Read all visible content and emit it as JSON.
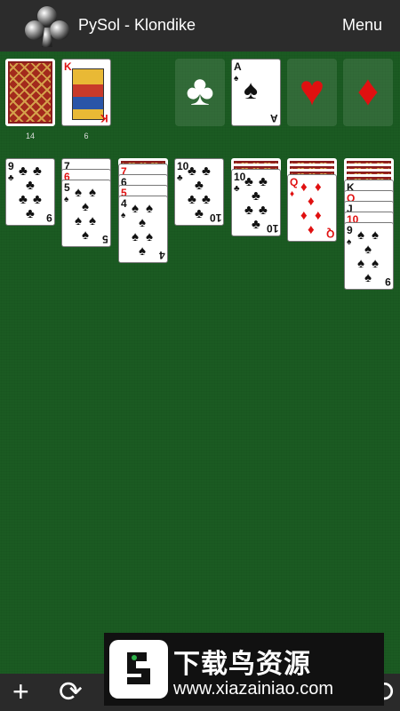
{
  "appbar": {
    "title": "PySol - Klondike",
    "menu_label": "Menu",
    "icon": "club-icon"
  },
  "stock": {
    "count": "14"
  },
  "waste": {
    "count": "6",
    "top_card": {
      "rank": "K",
      "suit": "♥"
    }
  },
  "foundations": [
    {
      "suit": "♣",
      "color": "#ffffff",
      "card": null
    },
    {
      "suit": "♠",
      "color": "#111111",
      "card": {
        "rank": "A",
        "suit": "♠"
      }
    },
    {
      "suit": "♥",
      "color": "#e01010",
      "card": null
    },
    {
      "suit": "♦",
      "color": "#e01010",
      "card": null
    }
  ],
  "tableau": [
    {
      "hidden": 0,
      "cards": [
        {
          "rank": "9",
          "suit": "♣",
          "color": "black"
        }
      ]
    },
    {
      "hidden": 0,
      "cards": [
        {
          "rank": "7",
          "suit": "♠",
          "color": "black"
        },
        {
          "rank": "6",
          "suit": "♦",
          "color": "red"
        },
        {
          "rank": "5",
          "suit": "♠",
          "color": "black"
        }
      ]
    },
    {
      "hidden": 1,
      "cards": [
        {
          "rank": "7",
          "suit": "♥",
          "color": "red"
        },
        {
          "rank": "6",
          "suit": "♣",
          "color": "black"
        },
        {
          "rank": "5",
          "suit": "♥",
          "color": "red"
        },
        {
          "rank": "4",
          "suit": "♠",
          "color": "black"
        }
      ]
    },
    {
      "hidden": 0,
      "cards": [
        {
          "rank": "10",
          "suit": "♣",
          "color": "black"
        }
      ]
    },
    {
      "hidden": 2,
      "cards": [
        {
          "rank": "10",
          "suit": "♣",
          "color": "black"
        }
      ]
    },
    {
      "hidden": 3,
      "cards": [
        {
          "rank": "Q",
          "suit": "♦",
          "color": "red"
        }
      ]
    },
    {
      "hidden": 4,
      "cards": [
        {
          "rank": "K",
          "suit": "♠",
          "color": "black"
        },
        {
          "rank": "Q",
          "suit": "♦",
          "color": "red"
        },
        {
          "rank": "J",
          "suit": "♠",
          "color": "black"
        },
        {
          "rank": "10",
          "suit": "♦",
          "color": "red"
        },
        {
          "rank": "9",
          "suit": "♠",
          "color": "black"
        }
      ]
    }
  ],
  "toolbar": {
    "new_icon": "+",
    "restart_icon": "⟳",
    "undo_icon": "↶",
    "redo_icon": "⟲"
  },
  "ad": {
    "title": "下载鸟资源",
    "url": "www.xiazainiao.com"
  }
}
